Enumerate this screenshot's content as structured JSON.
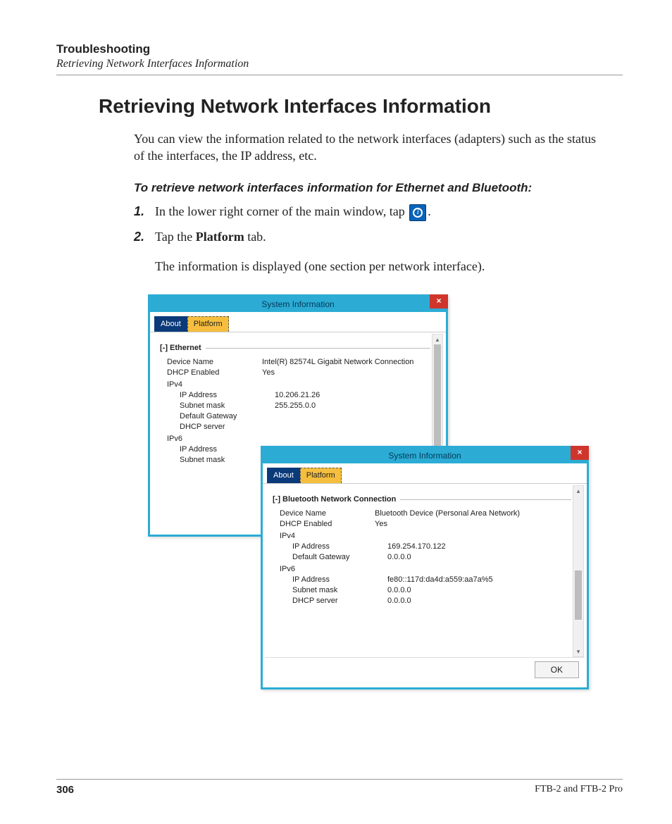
{
  "header": {
    "chapter": "Troubleshooting",
    "section": "Retrieving Network Interfaces Information"
  },
  "title": "Retrieving Network Interfaces Information",
  "intro": "You can view the information related to the network interfaces (adapters) such as the status of the interfaces, the IP address, etc.",
  "subhead": "To retrieve network interfaces information for Ethernet and Bluetooth:",
  "steps": {
    "s1_num": "1.",
    "s1a": "In the lower right corner of the main window, tap ",
    "s1b": ".",
    "s2_num": "2.",
    "s2a": "Tap the ",
    "s2b": "Platform",
    "s2c": " tab."
  },
  "after_steps": "The information is displayed (one section per network interface).",
  "win": {
    "title": "System Information",
    "close": "×",
    "tab_about": "About",
    "tab_platform": "Platform",
    "ok": "OK"
  },
  "eth": {
    "section": "[-] Ethernet",
    "device_name_k": "Device Name",
    "device_name_v": "Intel(R) 82574L Gigabit Network Connection",
    "dhcp_k": "DHCP Enabled",
    "dhcp_v": "Yes",
    "ipv4": "IPv4",
    "ip_k": "IP Address",
    "ip_v": "10.206.21.26",
    "mask_k": "Subnet mask",
    "mask_v": "255.255.0.0",
    "gw_k": "Default Gateway",
    "dhcpsrv_k": "DHCP server",
    "ipv6": "IPv6",
    "ip6_k": "IP Address",
    "mask6_k": "Subnet mask"
  },
  "bt": {
    "section": "[-] Bluetooth Network Connection",
    "device_name_k": "Device Name",
    "device_name_v": "Bluetooth Device (Personal Area Network)",
    "dhcp_k": "DHCP Enabled",
    "dhcp_v": "Yes",
    "ipv4": "IPv4",
    "ip_k": "IP Address",
    "ip_v": "169.254.170.122",
    "gw_k": "Default Gateway",
    "gw_v": "0.0.0.0",
    "ipv6": "IPv6",
    "ip6_k": "IP Address",
    "ip6_v": "fe80::117d:da4d:a559:aa7a%5",
    "mask6_k": "Subnet mask",
    "mask6_v": "0.0.0.0",
    "dhcpsrv_k": "DHCP server",
    "dhcpsrv_v": "0.0.0.0"
  },
  "footer": {
    "page": "306",
    "doc": "FTB-2 and FTB-2 Pro"
  }
}
